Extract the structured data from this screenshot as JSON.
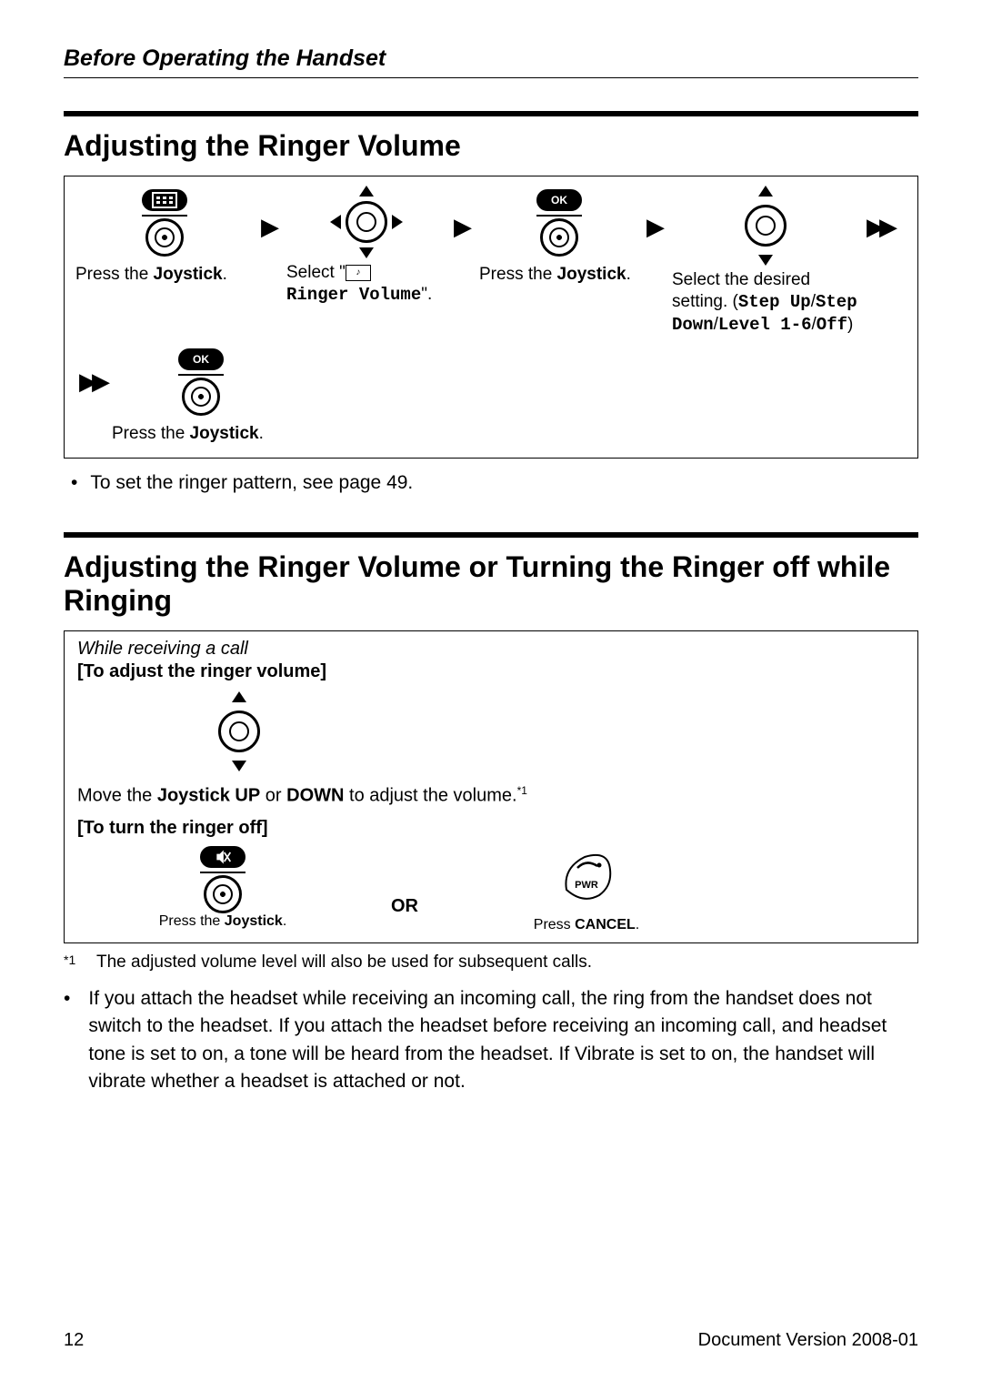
{
  "running_head": "Before Operating the Handset",
  "section1": {
    "title": "Adjusting the Ringer Volume",
    "steps": {
      "s1": {
        "caption_pre": "Press the ",
        "caption_bold": "Joystick",
        "caption_post": "."
      },
      "s2": {
        "caption_pre": "Select \"",
        "caption_icon_alt": "ringer icon",
        "caption_mono": "Ringer Volume",
        "caption_post": "\"."
      },
      "s3": {
        "caption_pre": "Press the ",
        "caption_bold": "Joystick",
        "caption_post": "."
      },
      "s4": {
        "caption_pre": "Select the desired setting. (",
        "opt1": "Step Up",
        "slash1": "/",
        "opt2": "Step Down",
        "slash2": "/",
        "opt3": "Level 1-6",
        "slash3": "/",
        "opt4": "Off",
        "caption_post": ")"
      },
      "s5": {
        "caption_pre": "Press the ",
        "caption_bold": "Joystick",
        "caption_post": "."
      }
    },
    "ok_label": "OK",
    "note": "To set the ringer pattern, see page 49."
  },
  "section2": {
    "title": "Adjusting the Ringer Volume or Turning the Ringer off while Ringing",
    "while_label": "While receiving a call",
    "adjust_label": "[To adjust the ringer volume]",
    "adjust_text_pre": "Move the ",
    "adjust_text_b1": "Joystick UP",
    "adjust_text_mid": " or ",
    "adjust_text_b2": "DOWN",
    "adjust_text_post": " to adjust the volume.",
    "adjust_sup": "*1",
    "turnoff_label": "[To turn the ringer off]",
    "or_label": "OR",
    "pwr_label": "PWR",
    "left_caption_pre": "Press the ",
    "left_caption_bold": "Joystick",
    "left_caption_post": ".",
    "right_caption_pre": "Press ",
    "right_caption_bold": "CANCEL",
    "right_caption_post": ".",
    "footnote_mark": "*1",
    "footnote_text": "The adjusted volume level will also be used for subsequent calls.",
    "long_note": "If you attach the headset while receiving an incoming call, the ring from the handset does not switch to the headset. If you attach the headset before receiving an incoming call, and headset tone is set to on, a tone will be heard from the headset. If Vibrate is set to on, the handset will vibrate whether a headset is attached or not."
  },
  "footer": {
    "page_number": "12",
    "doc_version": "Document Version  2008-01"
  }
}
